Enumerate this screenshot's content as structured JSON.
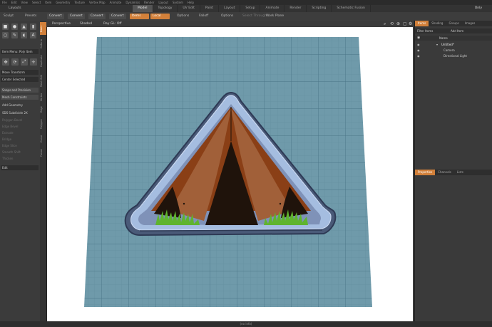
{
  "menu": [
    "File",
    "Edit",
    "View",
    "Select",
    "Item",
    "Geometry",
    "Texture",
    "Vertex Map",
    "Animate",
    "Dynamics",
    "Render",
    "Layout",
    "System",
    "Help"
  ],
  "layout": {
    "label": "Layouts",
    "mode_tabs": [
      "Model",
      "Topology",
      "UV Edit",
      "Paint",
      "Layout",
      "Setup",
      "Animate",
      "Render",
      "Scripting",
      "Schematic Fusion"
    ],
    "active_tab": "Model",
    "only_label": "Only"
  },
  "toolbar": {
    "sculpt": "Sculpt",
    "presets": "Presets",
    "convert1": "Convert",
    "convert2": "Convert",
    "convert3": "Convert",
    "convert4": "Convert",
    "items": "Items",
    "local": "Local",
    "options1": "Options",
    "falloff": "Falloff",
    "options2": "Options",
    "select_through": "Select Through",
    "work_plane": "Work Plane"
  },
  "left": {
    "tabs": [
      "Basic",
      "Deform",
      "Duplicate",
      "Mesh Edit",
      "Vertex",
      "Edge",
      "Polygon",
      "Curve",
      "Fusion"
    ],
    "item_menu": "Item Menu: Poly Item",
    "move_transform": "Move Transform",
    "center_selected": "Center Selected",
    "snaps": "Snaps and Precision",
    "mesh_constraints": "Mesh Constraints",
    "add_geometry": "Add Geometry",
    "sds_subdivide": "SDS Subdivide 2X",
    "dim_items": [
      "Polygon Bevel",
      "Edge Bevel",
      "Extrude",
      "Bridge",
      "Edge Slice",
      "Smooth Shift",
      "Thicken"
    ],
    "edit": "Edit"
  },
  "viewport": {
    "header": [
      "Perspective",
      "Shaded",
      "Ray GL: Off"
    ],
    "status": "(no info)",
    "colors": {
      "bg": "#ffffff",
      "grid": "#6f9aaa",
      "grid_line": "#4e7b8c",
      "tent_dark": "#1f130b",
      "tent_mid": "#8a3f16",
      "tent_light": "#a16039",
      "cutter": "#a5bde0",
      "grass": "#5fb42e"
    }
  },
  "right": {
    "tabs_top": [
      "Items",
      "Shading",
      "Groups",
      "Images"
    ],
    "filter_label": "Filter Items",
    "add_item": "Add Item",
    "col_name": "Name",
    "items": [
      "Untitled*",
      "Camera",
      "Directional Light"
    ],
    "tabs_bottom": [
      "Properties",
      "Channels",
      "Lists"
    ]
  }
}
